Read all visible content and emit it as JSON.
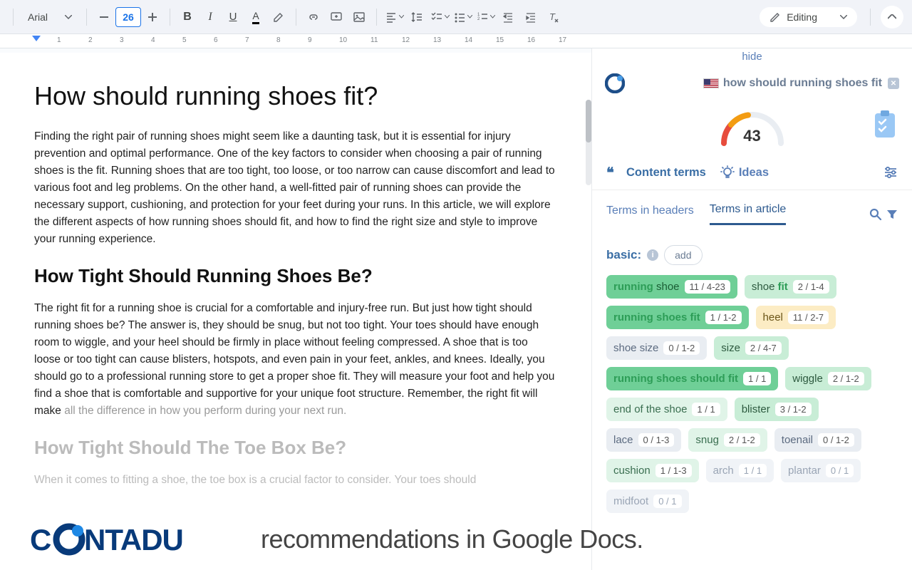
{
  "toolbar": {
    "font_name": "Arial",
    "font_size": "26",
    "editing_label": "Editing"
  },
  "ruler": {
    "marks": [
      "1",
      "2",
      "3",
      "4",
      "5",
      "6",
      "7",
      "8",
      "9",
      "10",
      "11",
      "12",
      "13",
      "14",
      "15",
      "16",
      "17"
    ]
  },
  "doc": {
    "title": "How should running shoes fit?",
    "para1": "Finding the right pair of running shoes might seem like a daunting task, but it is essential for injury prevention and optimal performance. One of the key factors to consider when choosing a pair of running shoes is the fit. Running shoes that are too tight, too loose, or too narrow can cause discomfort and lead to various foot and leg problems. On the other hand, a well-fitted pair of running shoes can provide the necessary support, cushioning, and protection for your feet during your runs. In this article, we will explore the different aspects of how running shoes should fit, and how to find the right size and style to improve your running experience.",
    "h2_1": "How Tight Should Running Shoes Be?",
    "para2_a": "The right fit for a running shoe is crucial for a comfortable and injury-free run. But just how tight should running shoes be? The answer is, they should be snug, but not too tight. Your toes should have enough room to wiggle, and your heel should be firmly in place without feeling compressed. A shoe that is too loose or too tight can cause blisters, hotspots, and even pain in your feet, ankles, and knees. Ideally, you should go to a professional running store to get a proper shoe fit. They will measure your foot and help you find a shoe that is comfortable and supportive for your unique foot structure. Remember, the right fit will make ",
    "para2_b": "all the difference in how you perform during your next run.",
    "h2_2": "How Tight Should The Toe Box Be?",
    "para3": "When it comes to fitting a shoe, the toe box is a crucial factor to consider. Your toes should"
  },
  "panel": {
    "hide": "hide",
    "keyword": "how should running shoes fit",
    "score": "43",
    "tab_content": "Content terms",
    "tab_ideas": "Ideas",
    "subtab_headers": "Terms in headers",
    "subtab_article": "Terms in article",
    "section_basic": "basic:",
    "add": "add"
  },
  "terms": [
    {
      "html": "<span class='match'>running</span> shoe",
      "count": "11 / 4-23",
      "cls": "green-strong"
    },
    {
      "html": "shoe <span class='match'>fit</span>",
      "count": "2 / 1-4",
      "cls": "green-light"
    },
    {
      "html": "<span class='match'>running shoes fit</span>",
      "count": "1 / 1-2",
      "cls": "green-strong"
    },
    {
      "html": "heel",
      "count": "11 / 2-7",
      "cls": "yellow"
    },
    {
      "html": "shoe size",
      "count": "0 / 1-2",
      "cls": "gray"
    },
    {
      "html": "size",
      "count": "2 / 4-7",
      "cls": "green-light"
    },
    {
      "html": "<span class='match'>running shoes should fit</span>",
      "count": "1 / 1",
      "cls": "green-strong"
    },
    {
      "html": "wiggle",
      "count": "2 / 1-2",
      "cls": "green-light"
    },
    {
      "html": "end of the shoe",
      "count": "1 / 1",
      "cls": "green-pale"
    },
    {
      "html": "blister",
      "count": "3 / 1-2",
      "cls": "green-light"
    },
    {
      "html": "lace",
      "count": "0 / 1-3",
      "cls": "gray"
    },
    {
      "html": "snug",
      "count": "2 / 1-2",
      "cls": "green-pale"
    },
    {
      "html": "toenail",
      "count": "0 / 1-2",
      "cls": "gray"
    },
    {
      "html": "cushion",
      "count": "1 / 1-3",
      "cls": "green-pale"
    },
    {
      "html": "arch",
      "count": "1 / 1",
      "cls": "gray-faded"
    },
    {
      "html": "plantar",
      "count": "0 / 1",
      "cls": "gray-faded"
    },
    {
      "html": "midfoot",
      "count": "0 / 1",
      "cls": "gray-faded"
    }
  ],
  "overlay": {
    "text": "recommendations in Google Docs."
  }
}
